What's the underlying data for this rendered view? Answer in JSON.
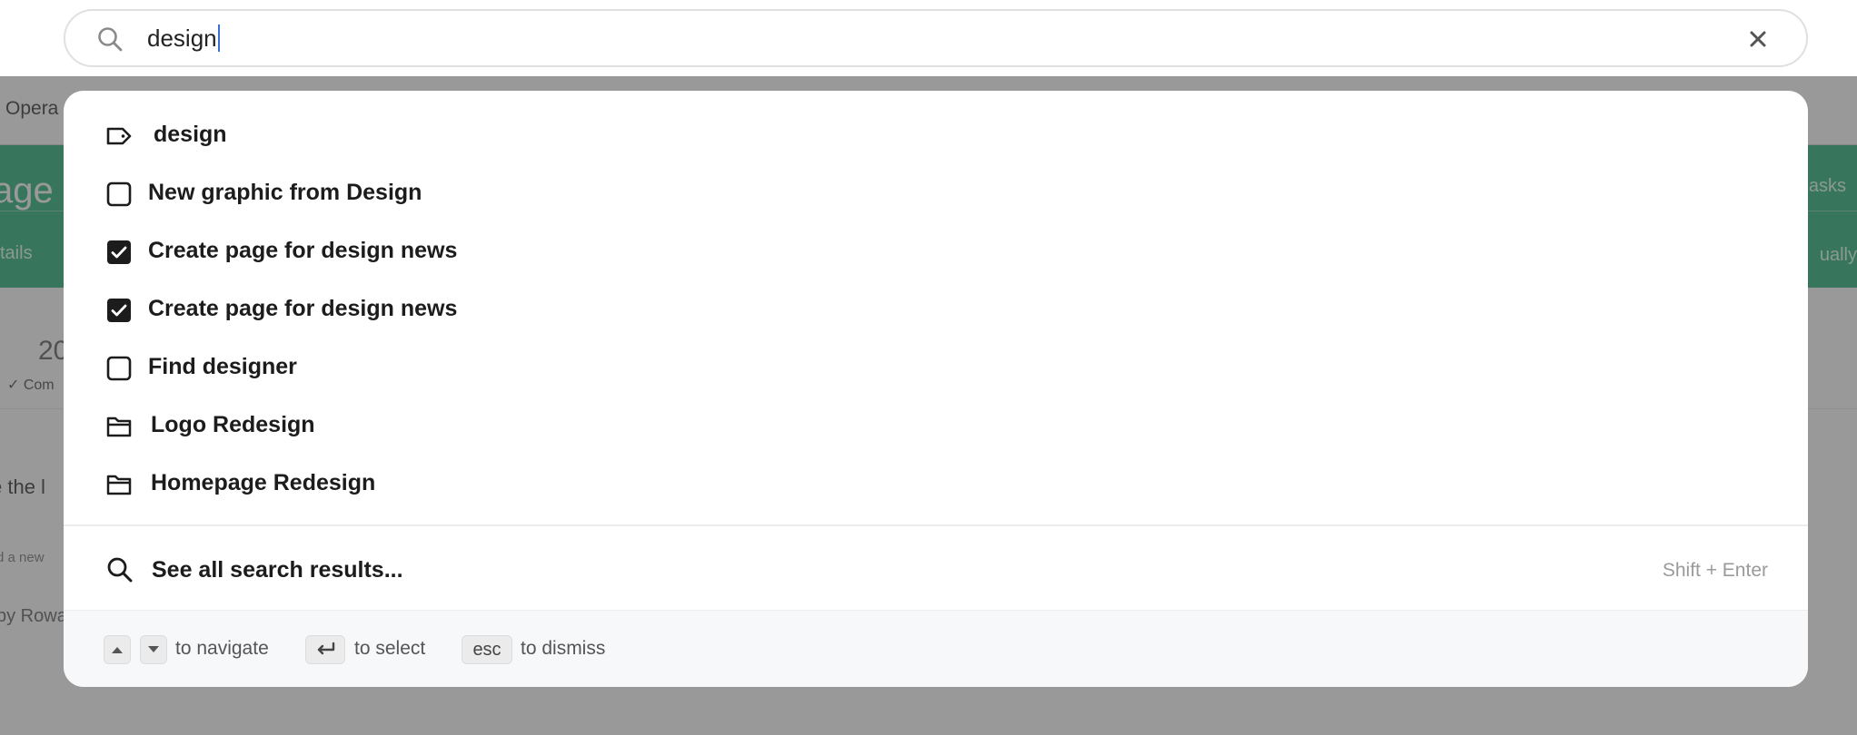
{
  "background": {
    "nav_item": "Opera",
    "hero_title": "age",
    "hero_tab": "tails",
    "hero_right_top": "asks",
    "hero_right_bottom": "ually",
    "stat_value": "20",
    "stat_caption": "✓ Com",
    "body_text_1": "e the l",
    "body_text_2": "d a new",
    "body_text_3": "by Rowa"
  },
  "search": {
    "value": "design",
    "icon": "search-icon",
    "clear_icon": "close-icon"
  },
  "results": [
    {
      "label": "design",
      "icon": "tag-icon",
      "kind": "tag"
    },
    {
      "label": "New graphic from Design",
      "icon": "checkbox-empty-icon",
      "kind": "task",
      "checked": false
    },
    {
      "label": "Create page for design news",
      "icon": "checkbox-checked-icon",
      "kind": "task",
      "checked": true
    },
    {
      "label": "Create page for design news",
      "icon": "checkbox-checked-icon",
      "kind": "task",
      "checked": true
    },
    {
      "label": "Find designer",
      "icon": "checkbox-empty-icon",
      "kind": "task",
      "checked": false
    },
    {
      "label": "Logo Redesign",
      "icon": "folder-icon",
      "kind": "project"
    },
    {
      "label": "Homepage Redesign",
      "icon": "folder-icon",
      "kind": "project"
    }
  ],
  "see_all": {
    "label": "See all search results...",
    "shortcut": "Shift + Enter",
    "icon": "search-icon"
  },
  "footer": {
    "navigate_text": "to navigate",
    "select_text": "to select",
    "esc_key": "esc",
    "dismiss_text": "to dismiss"
  },
  "colors": {
    "overlay": "#000000",
    "hero": "#5cc59b",
    "caret": "#3a6fd8",
    "text": "#1c1c1c",
    "muted": "#9a9a9a"
  }
}
